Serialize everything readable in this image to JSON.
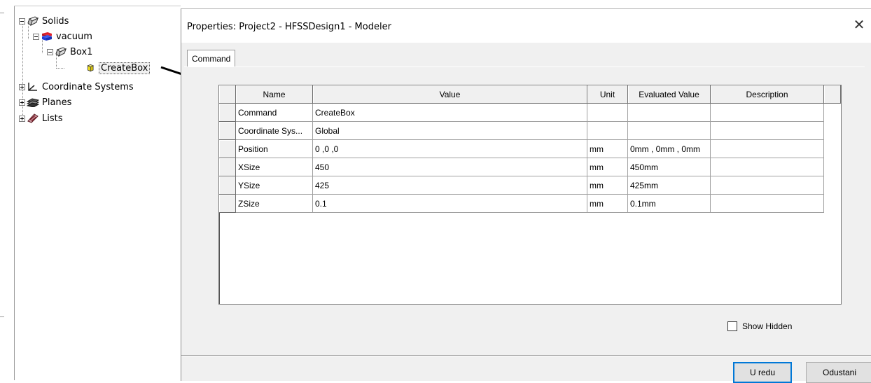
{
  "tree": {
    "items": [
      {
        "label": "Solids",
        "icon": "solid-box-icon"
      },
      {
        "label": "vacuum",
        "icon": "material-vacuum-icon"
      },
      {
        "label": "Box1",
        "icon": "box-object-icon"
      },
      {
        "label": "CreateBox",
        "icon": "create-box-command-icon"
      },
      {
        "label": "Coordinate Systems",
        "icon": "coordinate-system-icon"
      },
      {
        "label": "Planes",
        "icon": "planes-icon"
      },
      {
        "label": "Lists",
        "icon": "lists-icon"
      }
    ]
  },
  "dialog": {
    "title": "Properties: Project2 - HFSSDesign1 - Modeler",
    "close_label": "✕",
    "tab": "Command",
    "columns": [
      "Name",
      "Value",
      "Unit",
      "Evaluated Value",
      "Description"
    ],
    "rows": [
      [
        "Command",
        "CreateBox",
        "",
        "",
        ""
      ],
      [
        "Coordinate Sys...",
        "Global",
        "",
        "",
        ""
      ],
      [
        "Position",
        "0 ,0 ,0",
        "mm",
        "0mm , 0mm , 0mm",
        ""
      ],
      [
        "XSize",
        "450",
        "mm",
        "450mm",
        ""
      ],
      [
        "YSize",
        "425",
        "mm",
        "425mm",
        ""
      ],
      [
        "ZSize",
        "0.1",
        "mm",
        "0.1mm",
        ""
      ]
    ],
    "show_hidden_label": "Show Hidden",
    "show_hidden_checked": false,
    "ok_label": "U redu",
    "cancel_label": "Odustani"
  },
  "colors": {
    "vacuum_material": "#1f3fd8",
    "material_red": "#e0202a",
    "create_box_yellow": "#f4e21c"
  }
}
